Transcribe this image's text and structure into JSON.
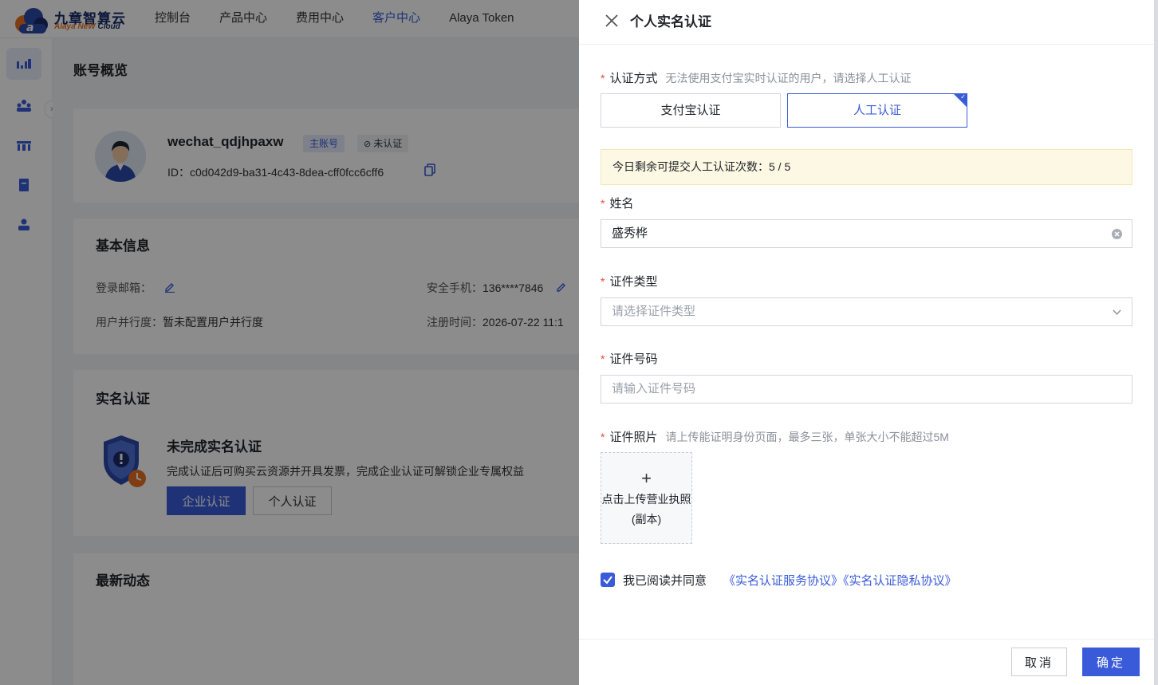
{
  "brand": {
    "name_cn": "九章智算云",
    "name_en_1": "Alaya NeW",
    "name_en_2": "Cloud"
  },
  "nav": [
    "控制台",
    "产品中心",
    "费用中心",
    "客户中心",
    "Alaya Token"
  ],
  "rail": {
    "expand_glyph": "›"
  },
  "page": {
    "title": "账号概览"
  },
  "account": {
    "username": "wechat_qdjhpaxw",
    "tag_main": "主账号",
    "tag_verify": "未认证",
    "id_text": "ID：c0d042d9-ba31-4c43-8dea-cff0fcc6cff6"
  },
  "basic": {
    "title": "基本信息",
    "email_label": "登录邮箱：",
    "phone_label": "安全手机：",
    "phone_value": "136****7846",
    "concurrency_label": "用户并行度：",
    "concurrency_value": "暂未配置用户并行度",
    "reg_label": "注册时间：",
    "reg_value": "2026-07-22 11:1"
  },
  "realname": {
    "title": "实名认证",
    "status_title": "未完成实名认证",
    "desc": "完成认证后可购买云资源并开具发票，完成企业认证可解锁企业专属权益",
    "enterprise_btn": "企业认证",
    "personal_btn": "个人认证"
  },
  "activity": {
    "title": "最新动态"
  },
  "drawer": {
    "title": "个人实名认证",
    "method_label": "认证方式",
    "method_hint": "无法使用支付宝实时认证的用户，请选择人工认证",
    "method_alipay": "支付宝认证",
    "method_manual": "人工认证",
    "notice": "今日剩余可提交人工认证次数：5 / 5",
    "name_label": "姓名",
    "name_value": "盛秀桦",
    "idtype_label": "证件类型",
    "idtype_placeholder": "请选择证件类型",
    "idno_label": "证件号码",
    "idno_placeholder": "请输入证件号码",
    "photo_label": "证件照片",
    "photo_hint": "请上传能证明身份页面，最多三张，单张大小不能超过5M",
    "upload_plus": "+",
    "upload_text": "点击上传营业执照(副本)",
    "agree_label": "我已阅读并同意",
    "agree_links": "《实名认证服务协议》《实名认证隐私协议》",
    "cancel": "取消",
    "ok": "确定"
  },
  "colors": {
    "accent": "#3a5bd9",
    "required": "#e84b3c",
    "notice_bg": "#fdf8e3"
  }
}
